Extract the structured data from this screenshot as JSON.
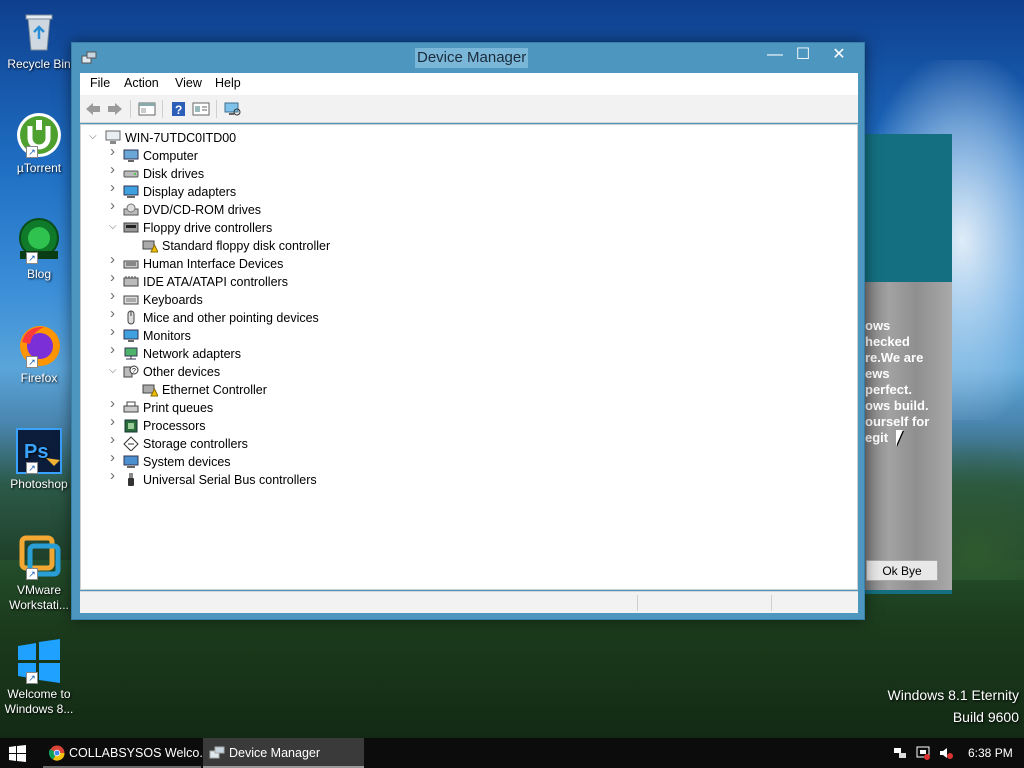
{
  "desktop": {
    "icons": [
      {
        "label": "Recycle Bin"
      },
      {
        "label": "µTorrent"
      },
      {
        "label": "Blog"
      },
      {
        "label": "Firefox"
      },
      {
        "label": "Photoshop"
      },
      {
        "label": "VMware Workstati..."
      },
      {
        "label": "Welcome to Windows 8..."
      }
    ],
    "watermark": {
      "line1": "Windows 8.1 Eternity",
      "line2": "Build 9600"
    }
  },
  "background_dialog": {
    "message": "ows\nhecked\nre.We are\news\nperfect.\nows build.\nourself for\negit",
    "button": "Ok Bye",
    "colors": {
      "header": "#146f80",
      "body": "#8f8f8f"
    }
  },
  "window": {
    "title": "Device Manager",
    "controls": {
      "minimize": "—",
      "maximize": "☐",
      "close": "✕"
    },
    "menu": [
      "File",
      "Action",
      "View",
      "Help"
    ],
    "toolbar_icons": [
      "back-arrow-icon",
      "forward-arrow-icon",
      "properties-pane-icon",
      "help-icon",
      "device-list-icon",
      "monitor-scan-icon"
    ],
    "tree": {
      "root": "WIN-7UTDC0ITD00",
      "items": [
        {
          "label": "Computer",
          "icon": "computer-icon",
          "expanded": false,
          "level": 1
        },
        {
          "label": "Disk drives",
          "icon": "disk-drive-icon",
          "expanded": false,
          "level": 1
        },
        {
          "label": "Display adapters",
          "icon": "display-adapter-icon",
          "expanded": false,
          "level": 1
        },
        {
          "label": "DVD/CD-ROM drives",
          "icon": "dvd-drive-icon",
          "expanded": false,
          "level": 1
        },
        {
          "label": "Floppy drive controllers",
          "icon": "floppy-controller-icon",
          "expanded": true,
          "level": 1
        },
        {
          "label": "Standard floppy disk controller",
          "icon": "warning-device-icon",
          "expanded": null,
          "level": 2
        },
        {
          "label": "Human Interface Devices",
          "icon": "hid-icon",
          "expanded": false,
          "level": 1
        },
        {
          "label": "IDE ATA/ATAPI controllers",
          "icon": "ide-controller-icon",
          "expanded": false,
          "level": 1
        },
        {
          "label": "Keyboards",
          "icon": "keyboard-icon",
          "expanded": false,
          "level": 1
        },
        {
          "label": "Mice and other pointing devices",
          "icon": "mouse-icon",
          "expanded": false,
          "level": 1
        },
        {
          "label": "Monitors",
          "icon": "monitor-icon",
          "expanded": false,
          "level": 1
        },
        {
          "label": "Network adapters",
          "icon": "network-adapter-icon",
          "expanded": false,
          "level": 1
        },
        {
          "label": "Other devices",
          "icon": "unknown-device-icon",
          "expanded": true,
          "level": 1
        },
        {
          "label": "Ethernet Controller",
          "icon": "warning-device-icon",
          "expanded": null,
          "level": 2
        },
        {
          "label": "Print queues",
          "icon": "printer-icon",
          "expanded": false,
          "level": 1
        },
        {
          "label": "Processors",
          "icon": "processor-icon",
          "expanded": false,
          "level": 1
        },
        {
          "label": "Storage controllers",
          "icon": "storage-controller-icon",
          "expanded": false,
          "level": 1
        },
        {
          "label": "System devices",
          "icon": "system-device-icon",
          "expanded": false,
          "level": 1
        },
        {
          "label": "Universal Serial Bus controllers",
          "icon": "usb-icon",
          "expanded": false,
          "level": 1
        }
      ]
    },
    "colors": {
      "frame": "#4d96c0",
      "title_highlight": "#7ab6d8"
    }
  },
  "taskbar": {
    "tasks": [
      {
        "label": "COLLABSYSOS Welco...",
        "icon": "chrome-icon"
      },
      {
        "label": "Device Manager",
        "icon": "device-manager-icon"
      }
    ],
    "tray_icons": [
      "network-icon",
      "flag-icon",
      "volume-muted-icon"
    ],
    "clock": "6:38 PM"
  }
}
